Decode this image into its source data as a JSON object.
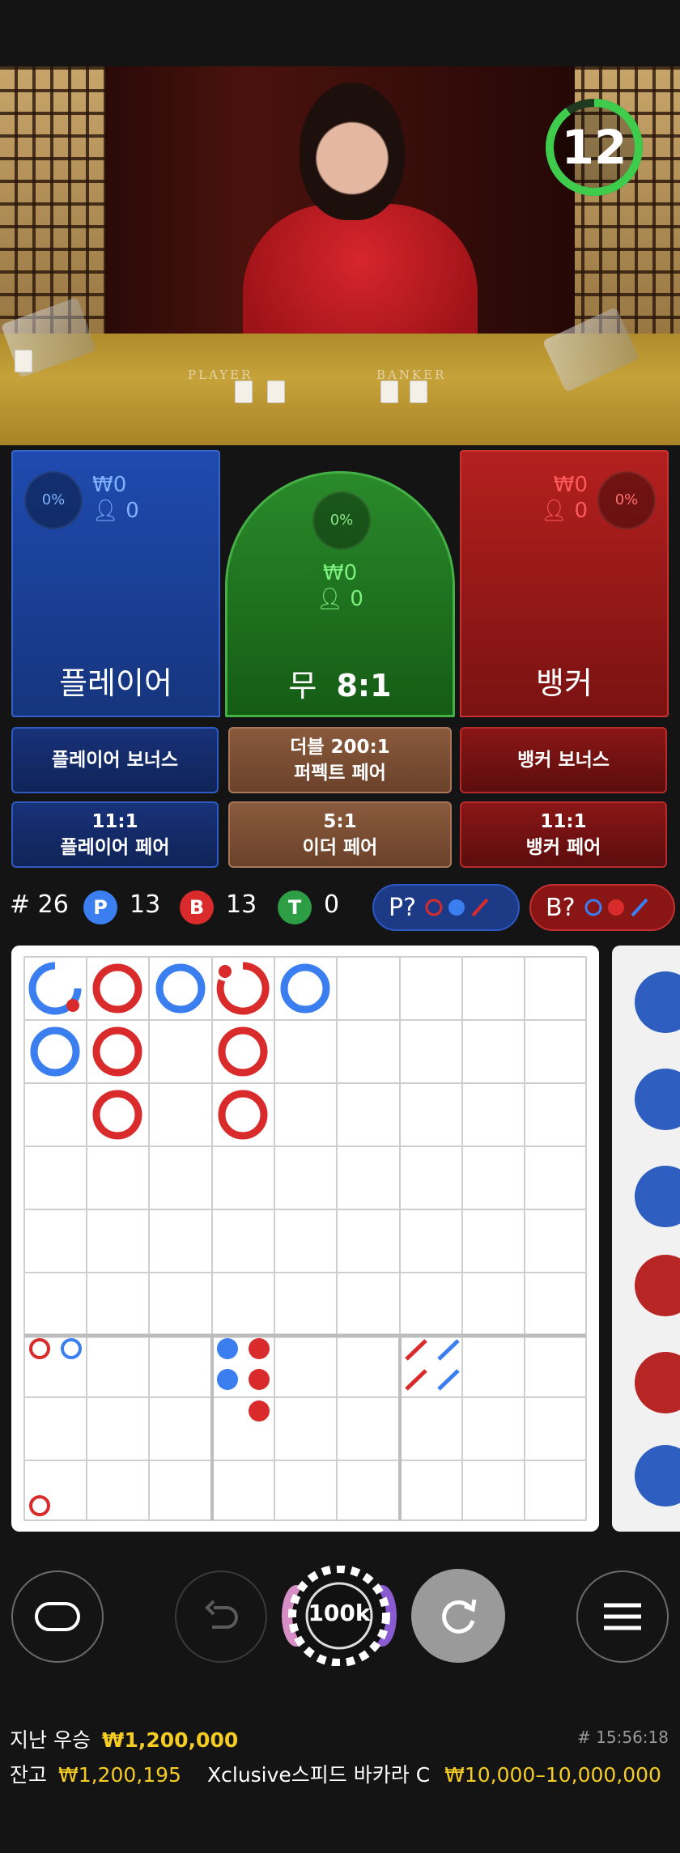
{
  "video": {
    "timer": "12",
    "zones": {
      "player": "PLAYER",
      "banker": "BANKER"
    }
  },
  "bets": {
    "player": {
      "label": "플레이어",
      "pct": "0%",
      "amount": "₩0",
      "count": "0"
    },
    "tie": {
      "label_main": "무",
      "label_odds": "8:1",
      "pct": "0%",
      "amount": "₩0",
      "count": "0"
    },
    "banker": {
      "label": "뱅커",
      "pct": "0%",
      "amount": "₩0",
      "count": "0"
    }
  },
  "side_bets": {
    "player_bonus": "플레이어 보너스",
    "double_perfect_line1": "더블 200:1",
    "double_perfect_line2": "퍼펙트 페어",
    "banker_bonus": "뱅커 보너스",
    "player_pair_odds": "11:1",
    "player_pair": "플레이어 페어",
    "either_pair_odds": "5:1",
    "either_pair": "이더 페어",
    "banker_pair_odds": "11:1",
    "banker_pair": "뱅커 페어"
  },
  "stats": {
    "round": "# 26",
    "p_letter": "P",
    "p_count": "13",
    "b_letter": "B",
    "b_count": "13",
    "t_letter": "T",
    "t_count": "0",
    "p_ask": "P?",
    "b_ask": "B?"
  },
  "roads": {
    "big_road": [
      {
        "col": 0,
        "row": 0,
        "side": "P",
        "icon": "circle",
        "note": "partial-with-red-dot"
      },
      {
        "col": 1,
        "row": 0,
        "side": "B"
      },
      {
        "col": 1,
        "row": 1,
        "side": "B"
      },
      {
        "col": 1,
        "row": 2,
        "side": "B"
      },
      {
        "col": 2,
        "row": 0,
        "side": "P"
      },
      {
        "col": 3,
        "row": 0,
        "side": "B",
        "note": "partial-with-red-dot"
      },
      {
        "col": 3,
        "row": 1,
        "side": "B"
      },
      {
        "col": 3,
        "row": 2,
        "side": "B"
      },
      {
        "col": 4,
        "row": 0,
        "side": "P"
      },
      {
        "col": 0,
        "row": 1,
        "side": "P"
      }
    ],
    "colors": {
      "player": "#3b7ef0",
      "banker": "#d92b2b",
      "tie": "#2e9e46"
    }
  },
  "controls": {
    "chip_value": "100k",
    "icons": [
      "chat-icon",
      "undo-icon",
      "chip-icon",
      "repeat-icon",
      "menu-icon"
    ]
  },
  "footer": {
    "last_win_label": "지난 우승",
    "last_win_value": "₩1,200,000",
    "time": "# 15:56:18",
    "balance_label": "잔고",
    "balance_value": "₩1,200,195",
    "table_name": "Xclusive스피드 바카라 C",
    "limits": "₩10,000–10,000,000"
  }
}
